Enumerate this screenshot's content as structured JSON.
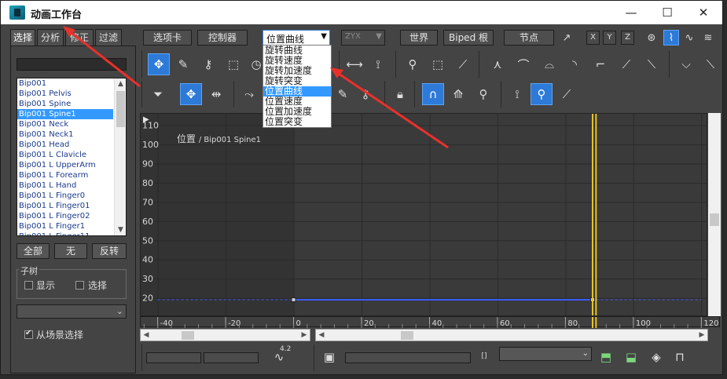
{
  "window": {
    "title": "动画工作台",
    "minimize": "—",
    "maximize": "☐",
    "close": "✕"
  },
  "left_panel": {
    "tabs": [
      "选择",
      "分析",
      "修正",
      "过滤"
    ],
    "objects": [
      "Bip001",
      "Bip001 Pelvis",
      "Bip001 Spine",
      "Bip001 Spine1",
      "Bip001 Neck",
      "Bip001 Neck1",
      "Bip001 Head",
      "Bip001 L Clavicle",
      "Bip001 L UpperArm",
      "Bip001 L Forearm",
      "Bip001 L Hand",
      "Bip001 L Finger0",
      "Bip001 L Finger01",
      "Bip001 L Finger02",
      "Bip001 L Finger1",
      "Bip001 L Finger11"
    ],
    "selected_index": 3,
    "buttons": {
      "all": "全部",
      "none": "无",
      "invert": "反转"
    },
    "subtree": {
      "label": "子树",
      "show": "显示",
      "select": "选择"
    },
    "from_scene": "从场景选择"
  },
  "top_row": {
    "tab_button": "选项卡",
    "controller_button": "控制器",
    "curve_combo": "位置曲线",
    "order_combo": "ZYX",
    "world_button": "世界",
    "biped_root_button": "Biped 根",
    "node_button": "节点",
    "axes": [
      "X",
      "Y",
      "Z"
    ]
  },
  "curve_menu": {
    "items": [
      "旋转曲线",
      "旋转速度",
      "旋转加速度",
      "旋转突变",
      "位置曲线",
      "位置速度",
      "位置加速度",
      "位置突变"
    ],
    "selected_index": 4
  },
  "graph": {
    "title": "位置",
    "subtitle": "/ Bip001 Spine1",
    "y_ticks": [
      "110",
      "100",
      "90",
      "80",
      "70",
      "60",
      "50",
      "40",
      "30",
      "20"
    ],
    "x_ticks": [
      "-40",
      "-20",
      "0",
      "20",
      "40",
      "60",
      "80",
      "100",
      "120"
    ],
    "play_marker": "▶"
  },
  "chart_data": {
    "type": "line",
    "title": "位置",
    "subtitle": "/ Bip001 Spine1",
    "xlim": [
      -45,
      122
    ],
    "ylim": [
      10,
      116
    ],
    "series": [
      {
        "x": [
          0,
          88
        ],
        "y": [
          19,
          19
        ],
        "color": "#3b5bff"
      }
    ],
    "reference_y": 19,
    "current_time_markers": [
      88,
      89
    ],
    "grid": true
  },
  "bottom": {
    "value_label": "4.2"
  },
  "colors": {
    "accent": "#2d7ad8",
    "selection": "#3399ff",
    "curve": "#3b5bff",
    "time_marker": "#e8c22a",
    "arrow": "#e8312a"
  }
}
